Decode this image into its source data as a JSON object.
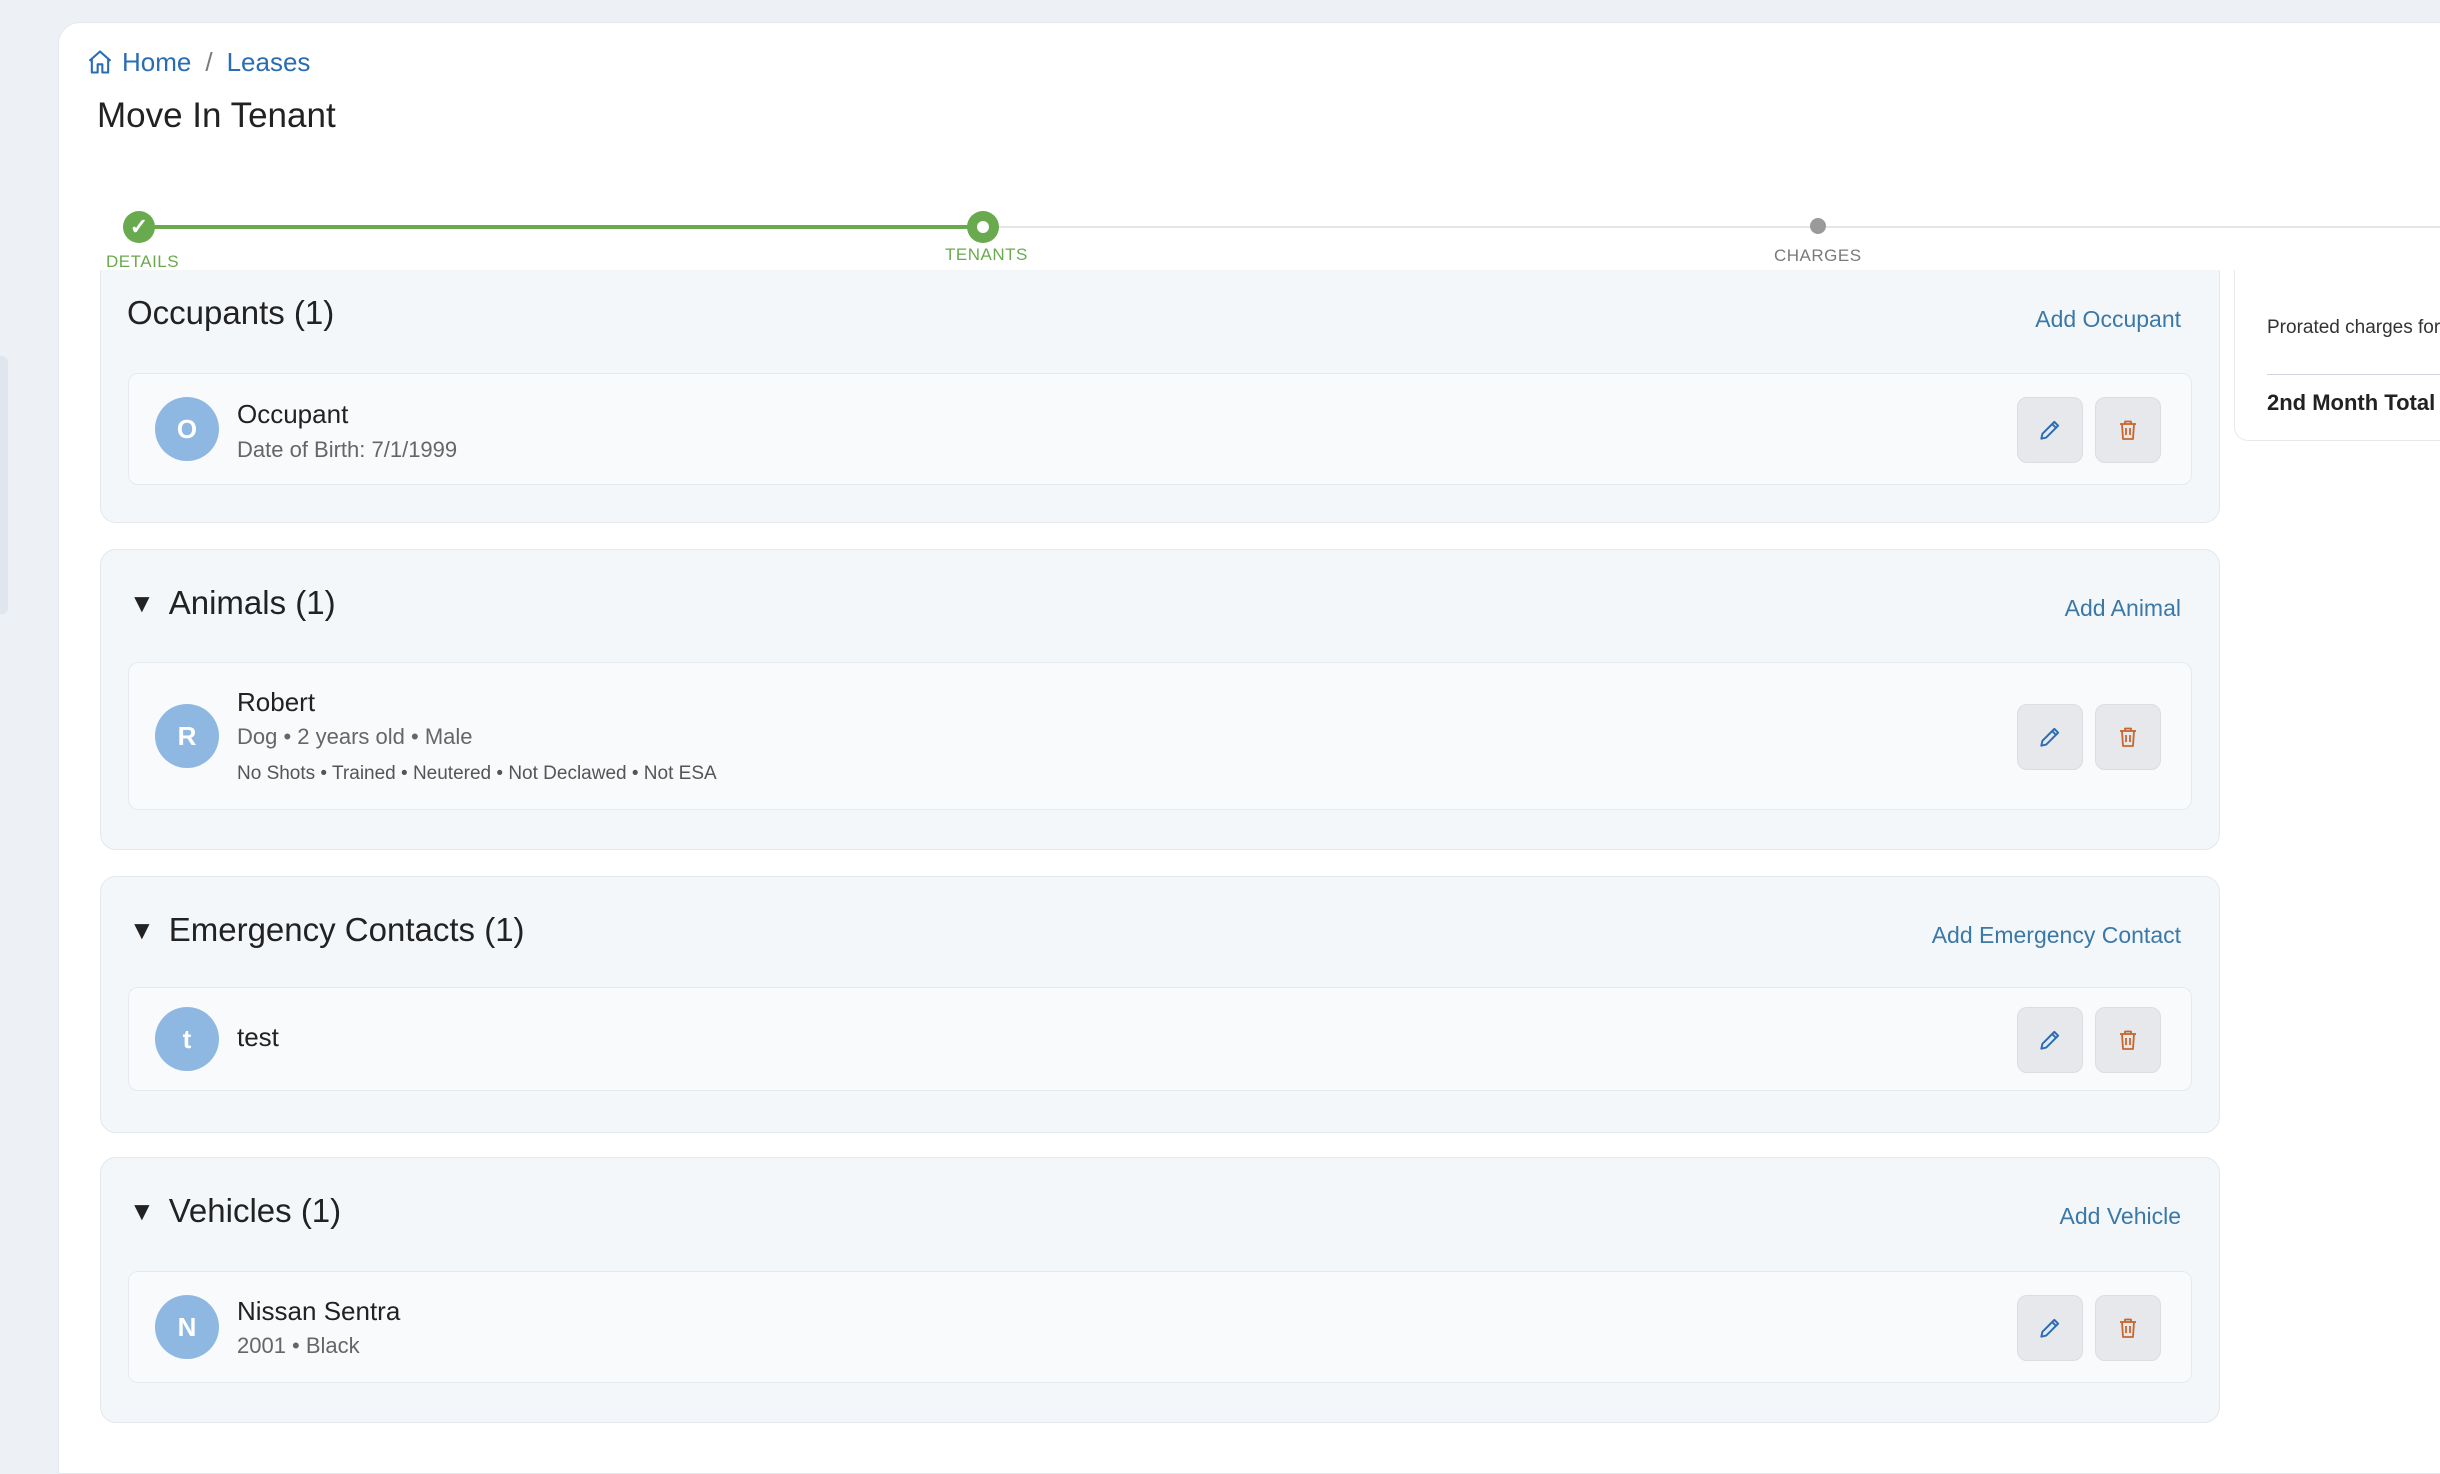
{
  "breadcrumb": {
    "home": "Home",
    "separator": "/",
    "leases": "Leases"
  },
  "page": {
    "title": "Move In Tenant"
  },
  "stepper": {
    "steps": [
      {
        "label": "DETAILS",
        "state": "complete"
      },
      {
        "label": "TENANTS",
        "state": "current"
      },
      {
        "label": "CHARGES",
        "state": "pending"
      }
    ],
    "check_glyph": "✓"
  },
  "occupants": {
    "title": "Occupants (1)",
    "add_label": "Add Occupant",
    "items": [
      {
        "initial": "O",
        "name": "Occupant",
        "detail": "Date of Birth: 7/1/1999"
      }
    ]
  },
  "animals": {
    "title": "Animals (1)",
    "add_label": "Add Animal",
    "items": [
      {
        "initial": "R",
        "name": "Robert",
        "detail": "Dog • 2 years old • Male",
        "attributes": "No Shots • Trained • Neutered • Not Declawed • Not ESA"
      }
    ]
  },
  "emergency_contacts": {
    "title": "Emergency Contacts (1)",
    "add_label": "Add Emergency Contact",
    "items": [
      {
        "initial": "t",
        "name": "test"
      }
    ]
  },
  "vehicles": {
    "title": "Vehicles (1)",
    "add_label": "Add Vehicle",
    "items": [
      {
        "initial": "N",
        "name": "Nissan Sentra",
        "detail": "2001 • Black"
      }
    ]
  },
  "summary": {
    "prorated_label": "Prorated charges for",
    "second_month_label": "2nd Month Total"
  },
  "collapse_glyph": "▼",
  "colors": {
    "accent_green": "#6aaa4f",
    "link_blue": "#2a6db5",
    "delete_orange": "#c9652c",
    "avatar_blue": "#8eb8e2"
  }
}
